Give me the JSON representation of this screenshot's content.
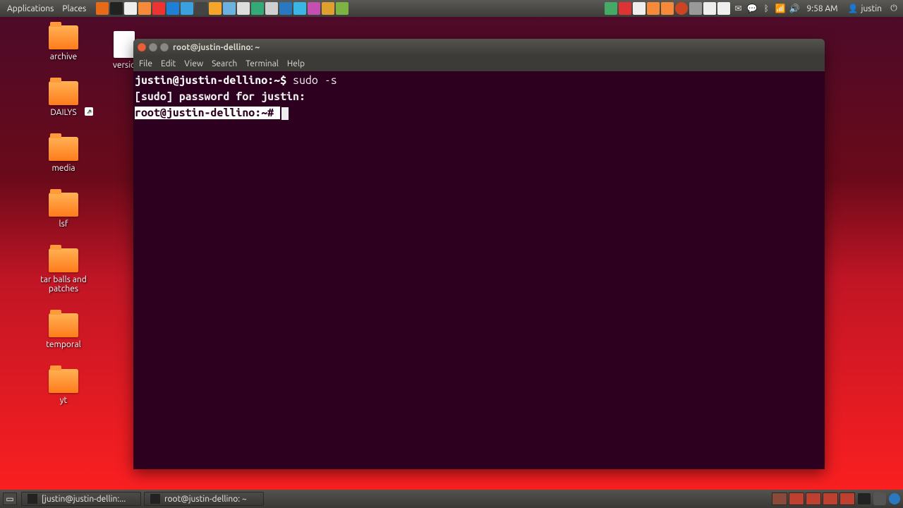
{
  "topbar": {
    "menus": [
      "Applications",
      "Places"
    ],
    "clock": "9:58 AM",
    "user": "justin"
  },
  "desktop": {
    "folders": [
      "archive",
      "DAILYS",
      "media",
      "lsf",
      "tar balls and patches",
      "temporal",
      "yt"
    ],
    "extra_doc": "versio"
  },
  "terminal": {
    "title": "root@justin-dellino: ~",
    "menus": [
      "File",
      "Edit",
      "View",
      "Search",
      "Terminal",
      "Help"
    ],
    "line1_prompt": "justin@justin-dellino:~$ ",
    "line1_cmd": "sudo -s",
    "line2": "[sudo] password for justin: ",
    "line3_prompt": "root@justin-dellino:~# "
  },
  "taskbar": {
    "tasks": [
      "[justin@justin-dellin:...",
      "root@justin-dellino: ~"
    ]
  }
}
